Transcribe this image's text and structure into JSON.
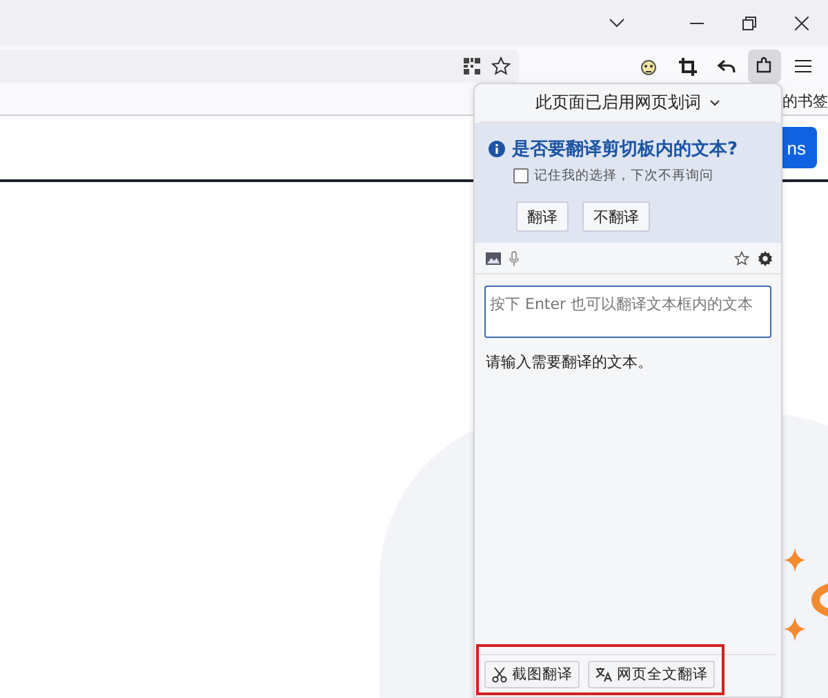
{
  "bookmarks_bar": {
    "item": "的书签"
  },
  "page": {
    "button": "ns"
  },
  "popup": {
    "title": "此页面已启用网页划词",
    "clipboard_prompt": {
      "question": "是否要翻译剪切板内的文本?",
      "remember": {
        "label": "记住我的选择，下次不再询问",
        "checked": false
      },
      "buttons": [
        "翻译",
        "不翻译"
      ]
    },
    "input": {
      "placeholder": "按下 Enter 也可以翻译文本框内的文本"
    },
    "result": "请输入需要翻译的文本。",
    "footer_buttons": [
      {
        "kind": "screenshot",
        "label": "截图翻译"
      },
      {
        "kind": "page",
        "label": "网页全文翻译"
      }
    ]
  }
}
